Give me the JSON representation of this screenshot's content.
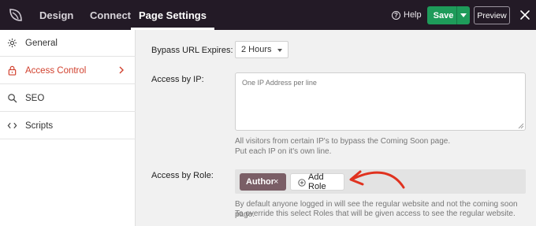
{
  "topbar": {
    "tabs": [
      {
        "label": "Design",
        "active": false
      },
      {
        "label": "Connect",
        "active": false
      },
      {
        "label": "Page Settings",
        "active": true
      }
    ],
    "help_label": "Help",
    "save_label": "Save",
    "preview_label": "Preview",
    "icons": {
      "logo": "seedprod-leaf-icon",
      "close": "close-icon",
      "help": "question-circle-icon",
      "dropdown": "caret-down-icon"
    }
  },
  "sidebar": {
    "items": [
      {
        "label": "General",
        "icon": "gear-icon",
        "active": false
      },
      {
        "label": "Access Control",
        "icon": "lock-icon",
        "active": true
      },
      {
        "label": "SEO",
        "icon": "search-icon",
        "active": false
      },
      {
        "label": "Scripts",
        "icon": "code-icon",
        "active": false
      }
    ]
  },
  "main": {
    "bypass_label": "Bypass URL Expires:",
    "bypass_value": "2 Hours",
    "ip_label": "Access by IP:",
    "ip_placeholder": "One IP Address per line",
    "ip_help_1": "All visitors from certain IP's to bypass the Coming Soon page.",
    "ip_help_2": "Put each IP on it's own line.",
    "role_label": "Access by Role:",
    "roles": [
      "Author"
    ],
    "remove_role_glyph": "×",
    "add_role_label": "Add Role",
    "role_help_1": "By default anyone logged in will see the regular website and not the coming soon page.",
    "role_help_2": "To override this select Roles that will be given access to see the regular website."
  },
  "colors": {
    "topbar_bg": "#231a26",
    "save_green": "#1e9b5a",
    "accent_red": "#d1412e",
    "role_chip": "#7a5e66",
    "annotation_arrow": "#e0321f"
  }
}
